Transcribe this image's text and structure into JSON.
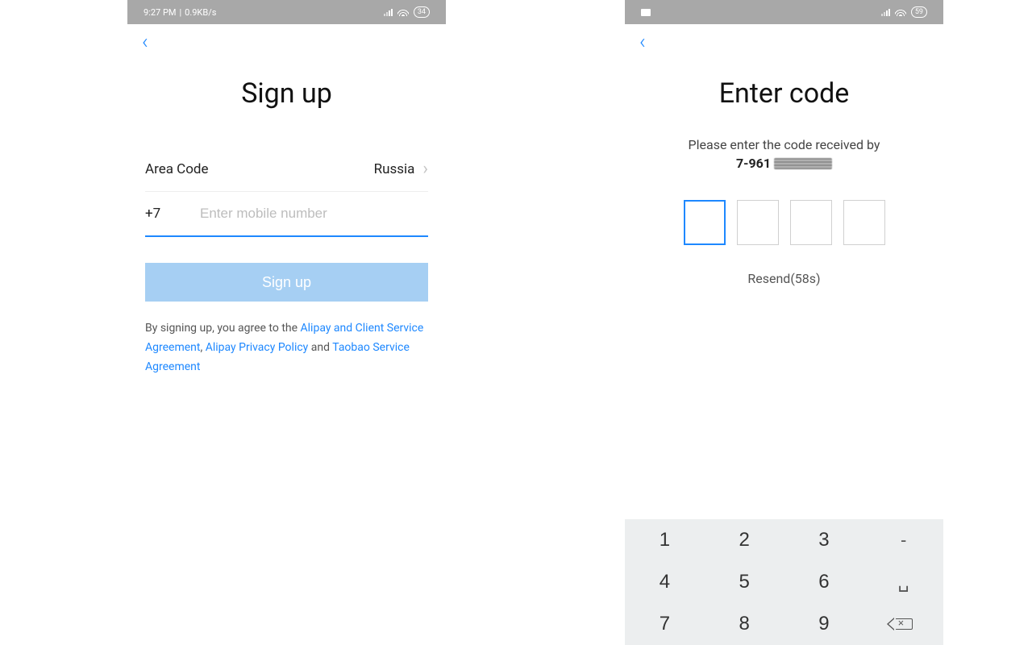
{
  "left": {
    "status": {
      "time": "9:27 PM",
      "net": "0.9KB/s",
      "battery": "34"
    },
    "title": "Sign up",
    "area_code_label": "Area Code",
    "area_code_value": "Russia",
    "phone_prefix": "+7",
    "phone_placeholder": "Enter mobile number",
    "signup_button": "Sign up",
    "terms": {
      "t1": "By signing up, you agree to the ",
      "link1": "Alipay and Client Service Agreement",
      "t2": ", ",
      "link2": "Alipay Privacy Policy",
      "t3": " and ",
      "link3": "Taobao Service Agreement"
    }
  },
  "right": {
    "status": {
      "battery": "59"
    },
    "title": "Enter code",
    "subtitle": "Please enter the code received by",
    "masked_number_prefix": "7-961",
    "resend": "Resend(58s)",
    "keypad": {
      "k1": "1",
      "k2": "2",
      "k3": "3",
      "dash": "-",
      "k4": "4",
      "k5": "5",
      "k6": "6",
      "k7": "7",
      "k8": "8",
      "k9": "9"
    }
  }
}
